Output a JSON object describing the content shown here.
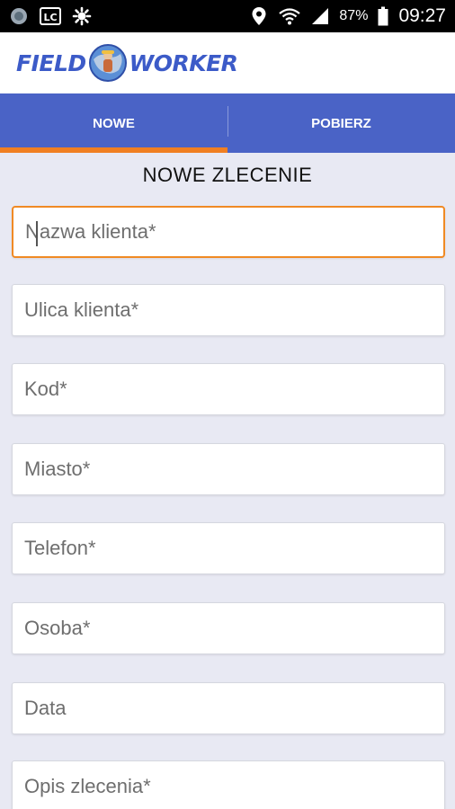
{
  "status_bar": {
    "icons_left": [
      "app-notification-icon",
      "lc-icon",
      "settings-gear-icon"
    ],
    "lc_label": "LC",
    "battery": "87%",
    "time": "09:27"
  },
  "app_bar": {
    "logo_left": "FIELD",
    "logo_right": "WORKER"
  },
  "tabs": [
    {
      "label": "NOWE",
      "active": true
    },
    {
      "label": "POBIERZ",
      "active": false
    }
  ],
  "colors": {
    "primary": "#4a63c6",
    "accent": "#f07f22",
    "background": "#e8e9f3"
  },
  "form": {
    "title": "NOWE ZLECENIE",
    "fields": [
      {
        "placeholder": "Nazwa klienta*",
        "value": ""
      },
      {
        "placeholder": "Ulica klienta*",
        "value": ""
      },
      {
        "placeholder": "Kod*",
        "value": ""
      },
      {
        "placeholder": "Miasto*",
        "value": ""
      },
      {
        "placeholder": "Telefon*",
        "value": ""
      },
      {
        "placeholder": "Osoba*",
        "value": ""
      },
      {
        "placeholder": "Data",
        "value": ""
      },
      {
        "placeholder": "Opis zlecenia*",
        "value": ""
      }
    ]
  }
}
